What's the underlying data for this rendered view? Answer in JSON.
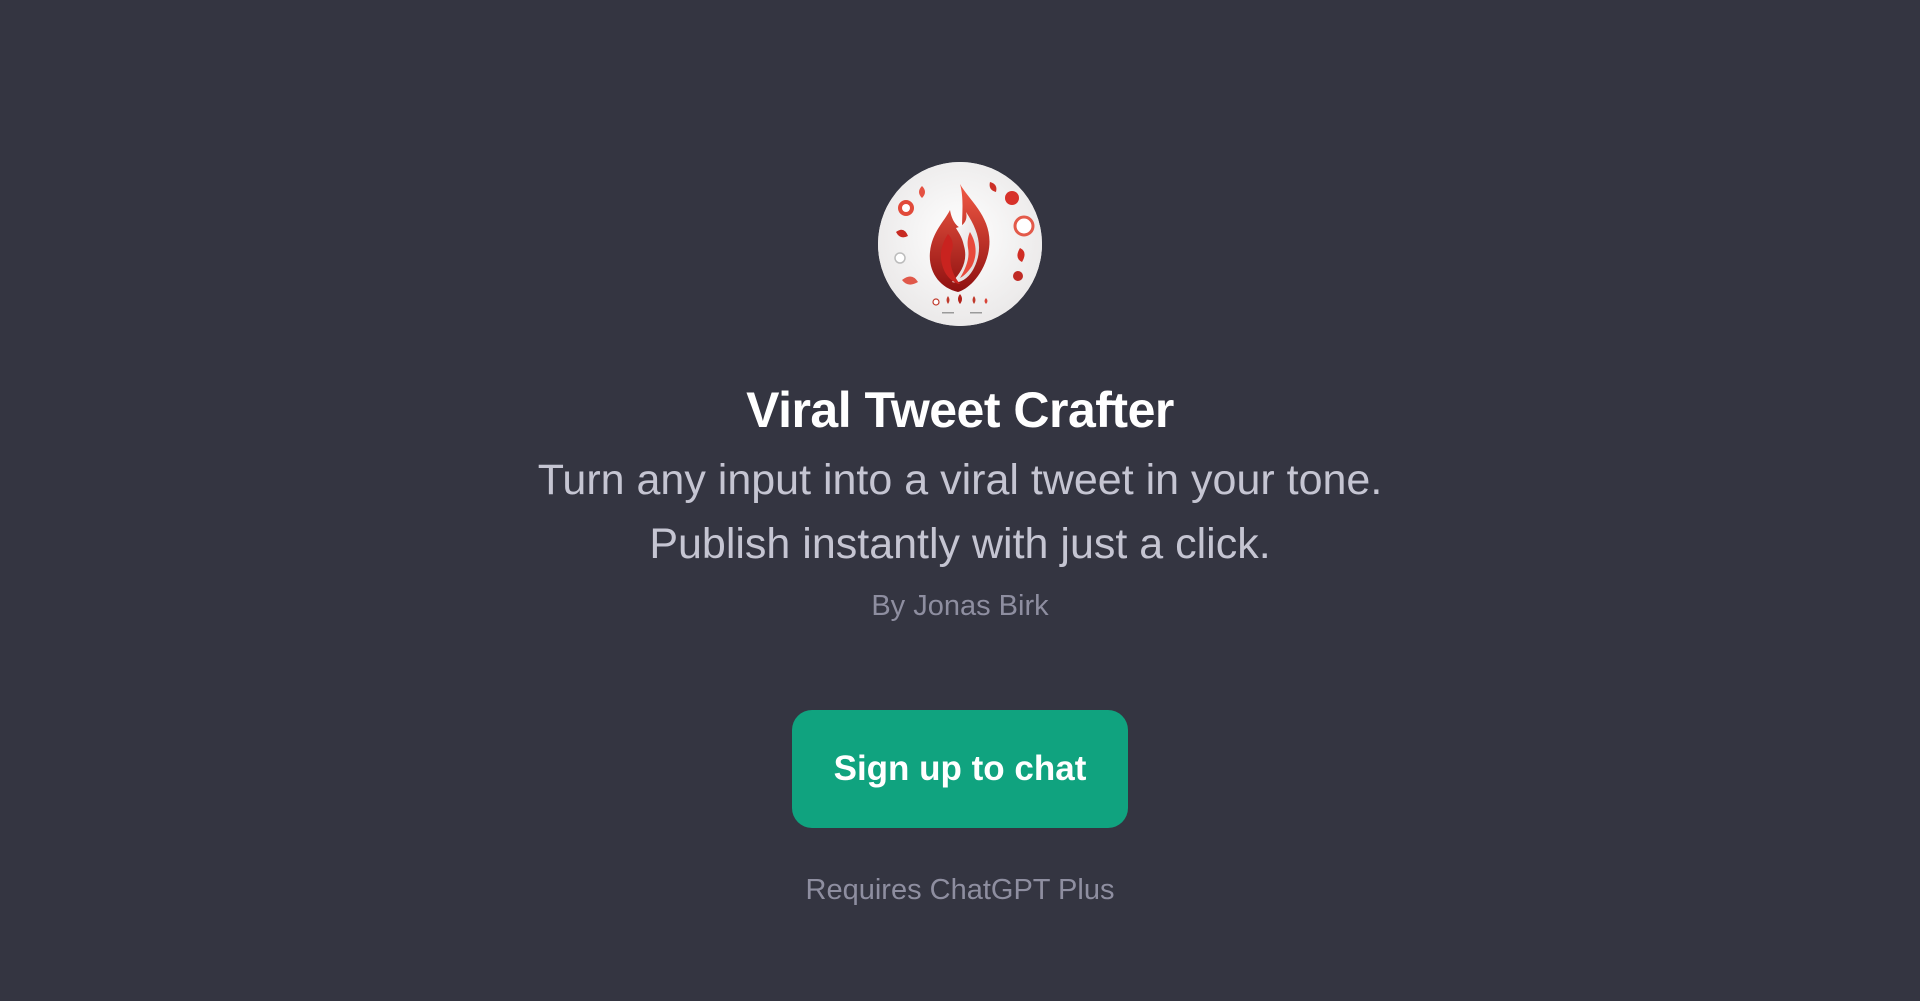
{
  "gpt": {
    "name": "Viral Tweet Crafter",
    "description_line1": "Turn any input into a viral tweet in your tone.",
    "description_line2": "Publish instantly with just a click.",
    "author": "By Jonas Birk",
    "avatar_icon": "red-flame-logo"
  },
  "cta": {
    "label": "Sign up to chat",
    "note": "Requires ChatGPT Plus"
  },
  "colors": {
    "background": "#343541",
    "title": "#ffffff",
    "description": "#c5c5d2",
    "muted": "#8e8ea0",
    "button": "#10a37f",
    "button_text": "#ffffff"
  }
}
